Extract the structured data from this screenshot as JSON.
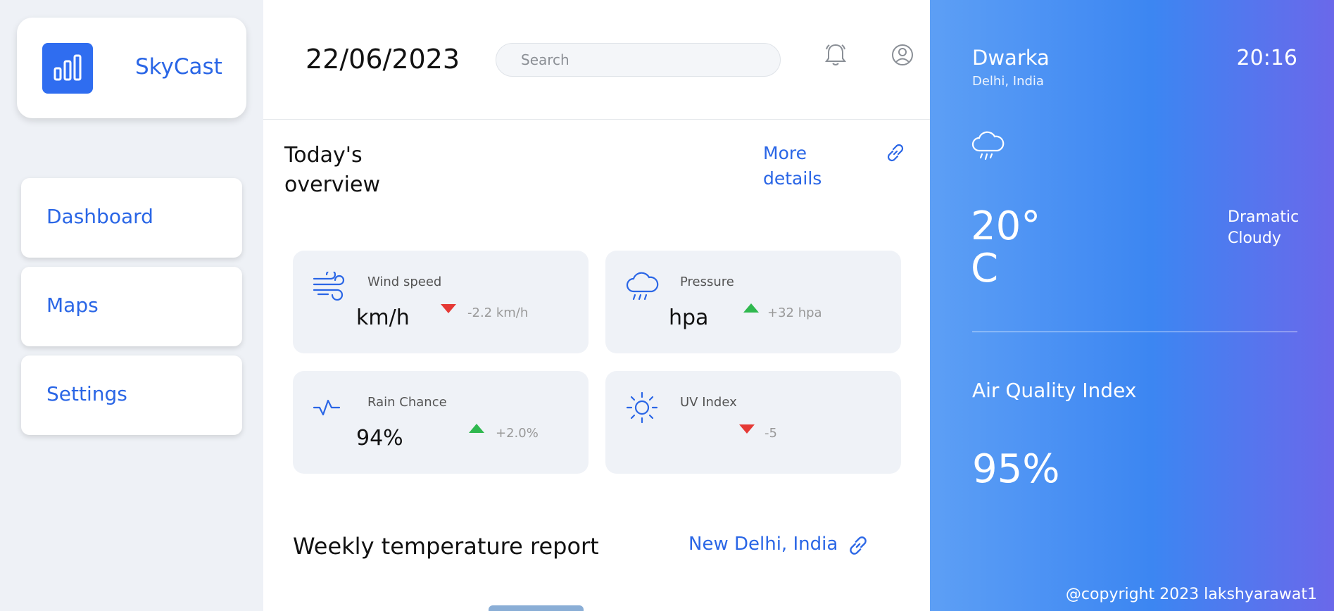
{
  "app": {
    "name": "SkyCast",
    "brand_color": "#2f6df0"
  },
  "sidebar": {
    "items": [
      {
        "label": "Dashboard"
      },
      {
        "label": "Maps"
      },
      {
        "label": "Settings"
      }
    ]
  },
  "header": {
    "date": "22/06/2023",
    "search_placeholder": "Search",
    "icons": [
      "bell-icon",
      "user-circle-icon"
    ]
  },
  "overview": {
    "title": "Today's overview",
    "more_details": "More details",
    "cards": [
      {
        "label": "Wind speed",
        "value": "km/h",
        "change": "-2.2 km/h",
        "trend": "down",
        "icon": "wind-icon"
      },
      {
        "label": "Pressure",
        "value": "hpa",
        "change": "+32 hpa",
        "trend": "up",
        "icon": "rain-cloud-icon"
      },
      {
        "label": "Rain Chance",
        "value": "94%",
        "change": "+2.0%",
        "trend": "up",
        "icon": "pulse-icon"
      },
      {
        "label": "UV Index",
        "value": "",
        "change": "-5",
        "trend": "down",
        "icon": "sun-icon"
      }
    ]
  },
  "weekly": {
    "title": "Weekly temperature report",
    "location": "New Delhi, India"
  },
  "current": {
    "city": "Dwarka",
    "region": "Delhi, India",
    "time": "20:16",
    "temperature": "20° C",
    "condition": "Dramatic Cloudy",
    "aqi_label": "Air Quality Index",
    "aqi_value": "95%",
    "icon": "rain-cloud-icon"
  },
  "footer": {
    "copyright": "@copyright 2023 lakshyarawat1"
  },
  "colors": {
    "accent": "#2a66e6",
    "trend_up": "#2fb84f",
    "trend_down": "#e53935"
  }
}
